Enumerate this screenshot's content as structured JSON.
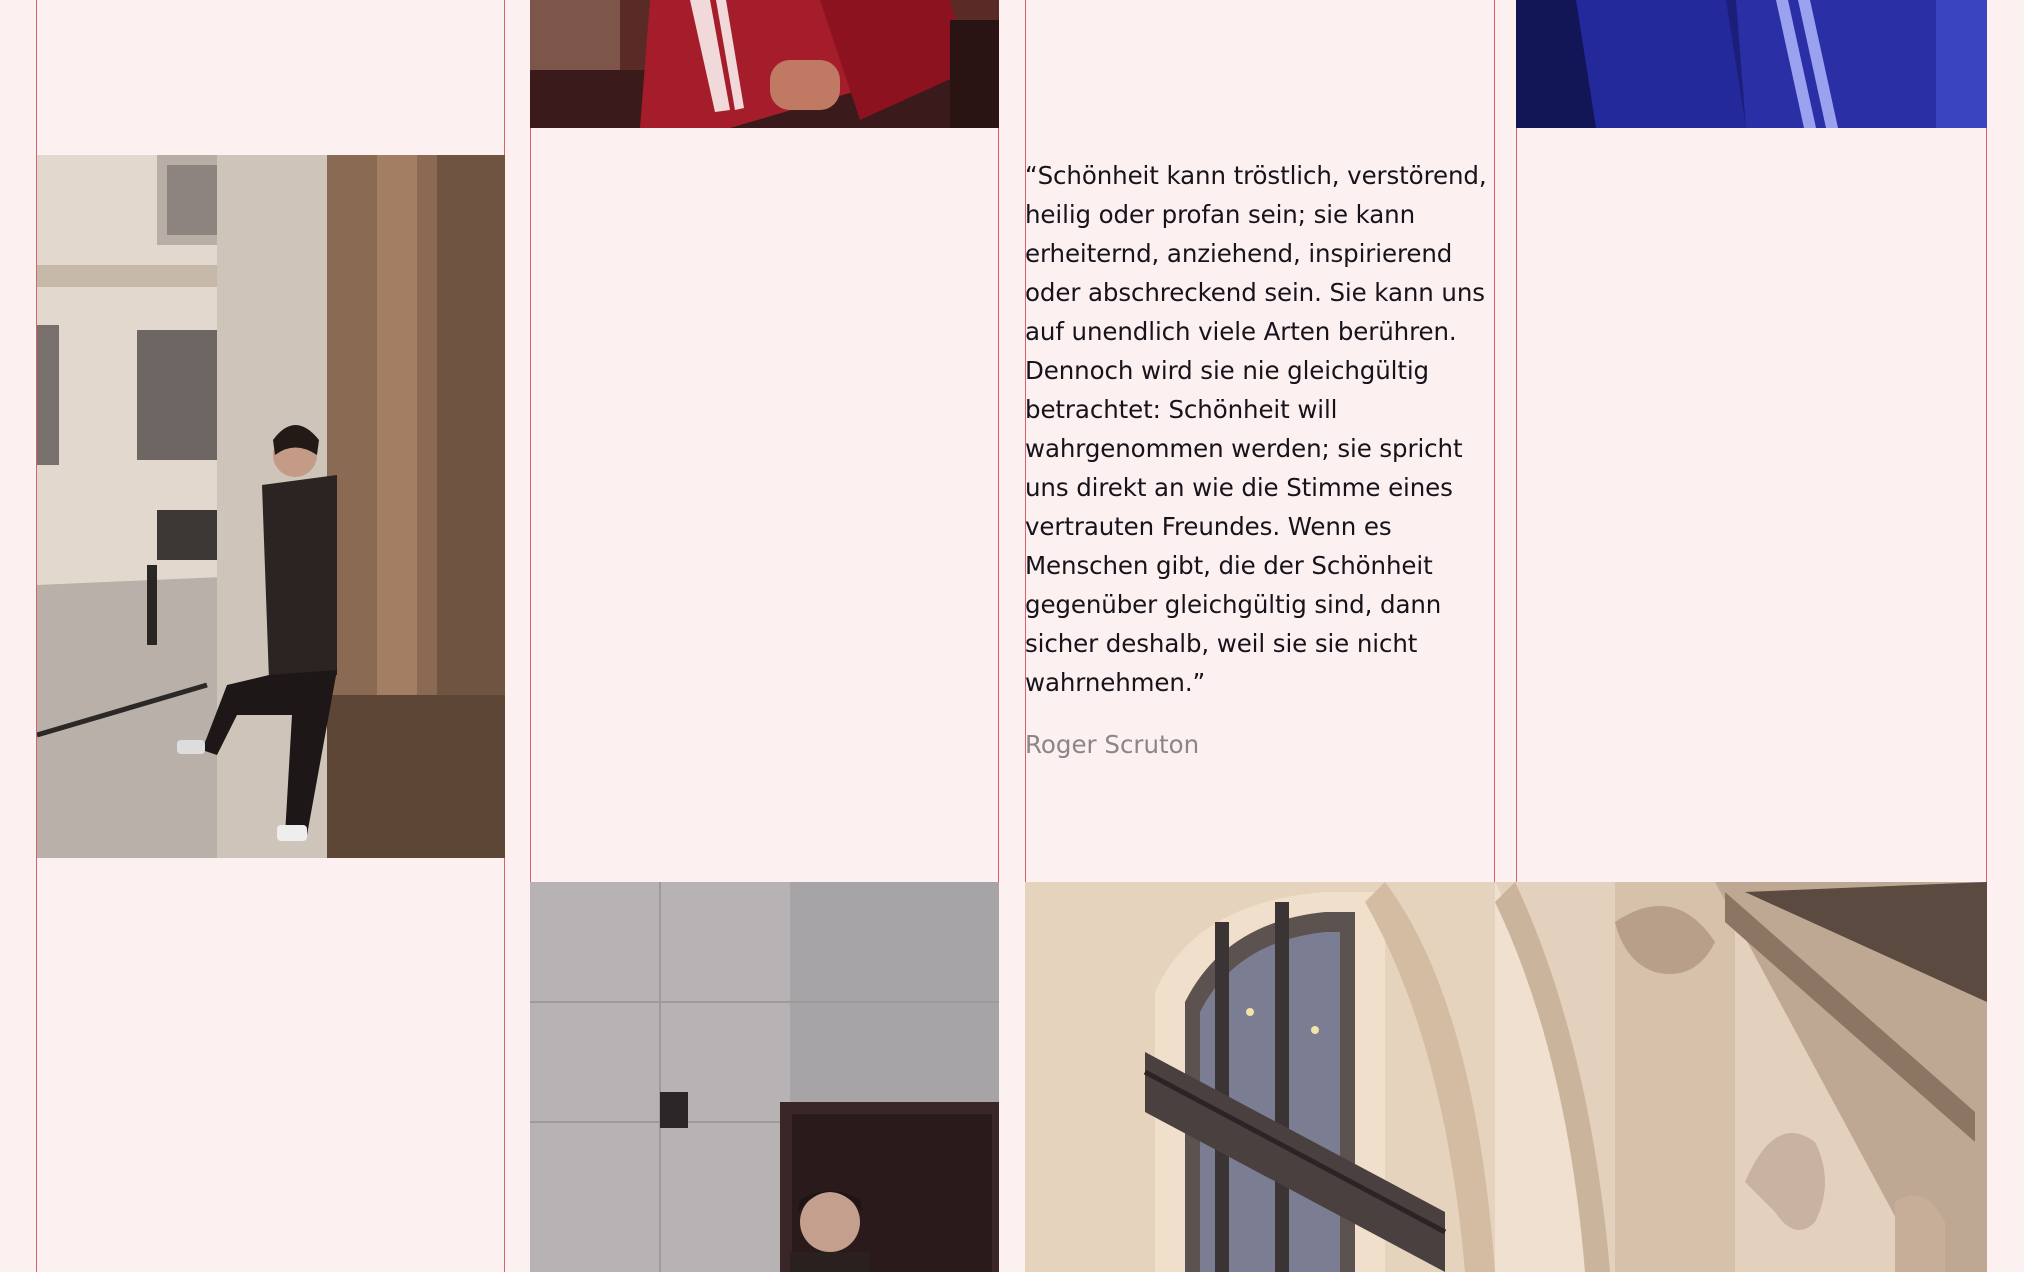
{
  "quote": {
    "text": "“Schönheit kann tröstlich, verstörend, heilig oder profan sein; sie kann erheiternd, anziehend, inspirierend oder abschreckend sein. Sie kann uns auf unendlich viele Arten berühren. Dennoch wird sie nie gleichgültig betrachtet: Schönheit will wahrgenommen werden; sie spricht uns direkt an wie die Stimme eines vertrauten Freundes. Wenn es Menschen gibt, die der Schönheit gegenüber gleichgültig sind, dann sicher deshalb, weil sie sie nicht wahrnehmen.”",
    "author": "Roger Scruton"
  },
  "colors": {
    "background": "#fdf0f1",
    "grid_line": "#d9626a",
    "quote_text": "#16131a",
    "author_text": "#8d8487"
  },
  "images": [
    {
      "name": "red-tracksuit-photo"
    },
    {
      "name": "blue-tracksuit-photo"
    },
    {
      "name": "man-leaning-on-pillar-photo"
    },
    {
      "name": "man-at-door-photo"
    },
    {
      "name": "arched-window-facade-photo"
    },
    {
      "name": "ornate-cornice-facade-photo"
    }
  ]
}
